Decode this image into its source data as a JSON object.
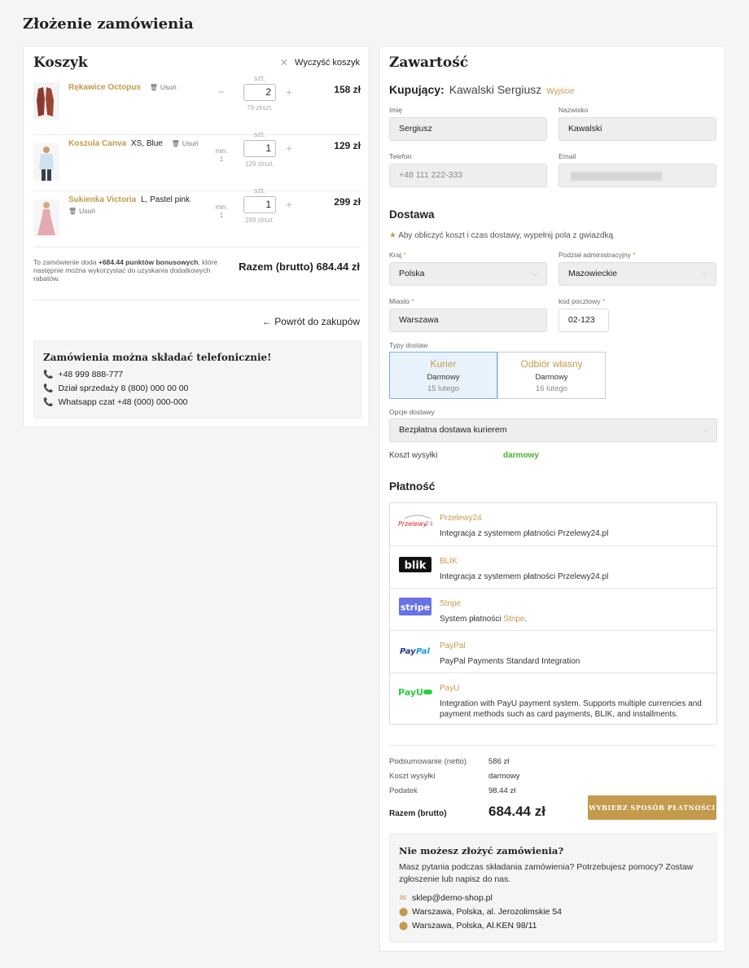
{
  "page": {
    "title": "Złożenie zamówienia"
  },
  "cart": {
    "title": "Koszyk",
    "clear_label": "Wyczyść koszyk",
    "qty_unit_label": "szt.",
    "items": [
      {
        "name": "Rękawice Octopus",
        "variant": "",
        "remove": "Usuń",
        "min": "",
        "qty": "2",
        "unit_price": "79 zł/szt.",
        "price": "158 zł"
      },
      {
        "name": "Koszula Canva",
        "variant": "XS, Blue",
        "remove": "Usuń",
        "min": "min.\n1",
        "qty": "1",
        "unit_price": "129 zł/szt.",
        "price": "129 zł"
      },
      {
        "name": "Sukienka Victoria",
        "variant": "L, Pastel pink",
        "remove": "Usuń",
        "min": "min.\n1",
        "qty": "1",
        "unit_price": "299 zł/szt.",
        "price": "299 zł"
      }
    ],
    "bonus_prefix": "To zamówienie doda ",
    "bonus_points": "+684.44 punktów bonusowych",
    "bonus_suffix": ", które następnie można wykorzystać do uzyskania dodatkowych rabatów.",
    "total": "Razem (brutto) 684.44 zł",
    "back_label": "← Powrót do zakupów",
    "phone_box": {
      "title": "Zamówienia można składać telefonicznie!",
      "lines": [
        "+48 999 888-777",
        "Dział sprzedaży 8 (800) 000 00 00",
        "Whatsapp czat +48 (000) 000-000"
      ]
    }
  },
  "details": {
    "title": "Zawartość",
    "buyer_label": "Kupujący:",
    "buyer_name": "Kawalski Sergiusz",
    "logout": "Wyjście",
    "fields": {
      "first_name_label": "Imię",
      "first_name": "Sergiusz",
      "last_name_label": "Nazwisko",
      "last_name": "Kawalski",
      "phone_label": "Telefon",
      "phone": "+48 111 222-333",
      "email_label": "Email",
      "email": ""
    },
    "delivery": {
      "title": "Dostawa",
      "note": "Aby obliczyć koszt i czas dostawy, wypełnij pola z gwiazdką",
      "country_label": "Kraj",
      "country": "Polska",
      "region_label": "Podział administracyjny",
      "region": "Mazowieckie",
      "city_label": "Miasto",
      "city": "Warszawa",
      "zip_label": "kod pocztowy",
      "zip": "02-123",
      "types_label": "Typy dostaw",
      "types": [
        {
          "title": "Kurier",
          "price": "Darmowy",
          "date": "15 lutego"
        },
        {
          "title": "Odbiór własny",
          "price": "Darmowy",
          "date": "16 lutego"
        }
      ],
      "options_label": "Opcje dostawy",
      "option": "Bezpłatna dostawa kurierem",
      "cost_label": "Koszt wysyłki",
      "cost_value": "darmowy"
    },
    "payment": {
      "title": "Płatność",
      "methods": [
        {
          "name": "Przelewy24",
          "desc": "Integracja z systemem płatności Przelewy24.pl",
          "logo": "Przelewy24"
        },
        {
          "name": "BLIK",
          "desc": "Integracja z systemem płatności Przelewy24.pl",
          "logo": "blik"
        },
        {
          "name": "Stripe",
          "desc_prefix": "System płatności ",
          "desc_link": "Stripe",
          "desc_suffix": ".",
          "logo": "stripe"
        },
        {
          "name": "PayPal",
          "desc": "PayPal Payments Standard Integration",
          "logo": "PayPal"
        },
        {
          "name": "PayU",
          "desc": "Integration with PayU payment system. Supports multiple currencies and payment methods such as card payments, BLIK, and installments.",
          "logo": "PayU"
        }
      ]
    },
    "summary": {
      "net_label": "Podsumowanie (netto)",
      "net": "586 zł",
      "shipping_label": "Koszt wysyłki",
      "shipping": "darmowy",
      "tax_label": "Podatek",
      "tax": "98.44 zł",
      "gross_label": "Razem (brutto)",
      "gross": "684.44 zł",
      "button": "WYBIERZ SPOSÓB PŁATNOŚCI"
    },
    "help": {
      "title": "Nie możesz złożyć zamówienia?",
      "text": "Masz pytania podczas składania zamówienia? Potrzebujesz pomocy? Zostaw zgłoszenie lub napisz do nas.",
      "email": "sklep@demo-shop.pl",
      "address1": "Warszawa, Polska, al. Jerozolimskie 54",
      "address2": "Warszawa, Polska, Al.KEN 98/11"
    }
  },
  "colors": {
    "accent": "#c49a4c",
    "free": "#4caf2f",
    "selected_bg": "#e8f2fc"
  }
}
